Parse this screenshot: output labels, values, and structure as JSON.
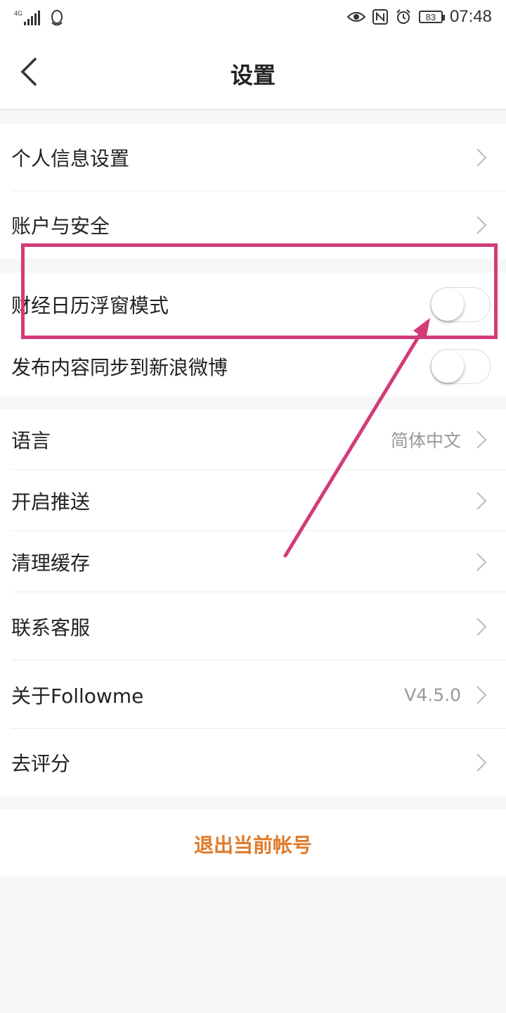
{
  "status_bar": {
    "network": "4G",
    "battery": "83",
    "time": "07:48",
    "icons": [
      "signal-icon",
      "qq-icon",
      "eye-icon",
      "nfc-icon",
      "alarm-icon",
      "battery-icon"
    ]
  },
  "nav": {
    "title": "设置",
    "back_icon": "chevron-left-icon"
  },
  "sections": {
    "profile": [
      {
        "label": "个人信息设置"
      },
      {
        "label": "账户与安全"
      }
    ],
    "toggles": [
      {
        "label": "财经日历浮窗模式",
        "on": false
      },
      {
        "label": "发布内容同步到新浪微博",
        "on": false
      }
    ],
    "misc": [
      {
        "label": "语言",
        "value": "简体中文"
      },
      {
        "label": "开启推送",
        "value": ""
      },
      {
        "label": "清理缓存",
        "value": ""
      },
      {
        "label": "联系客服",
        "value": ""
      },
      {
        "label": "关于Followme",
        "value": "V4.5.0"
      },
      {
        "label": "去评分",
        "value": ""
      }
    ]
  },
  "logout": {
    "label": "退出当前帐号",
    "color": "#e07a2a"
  },
  "annotation": {
    "color": "#d33b79"
  }
}
